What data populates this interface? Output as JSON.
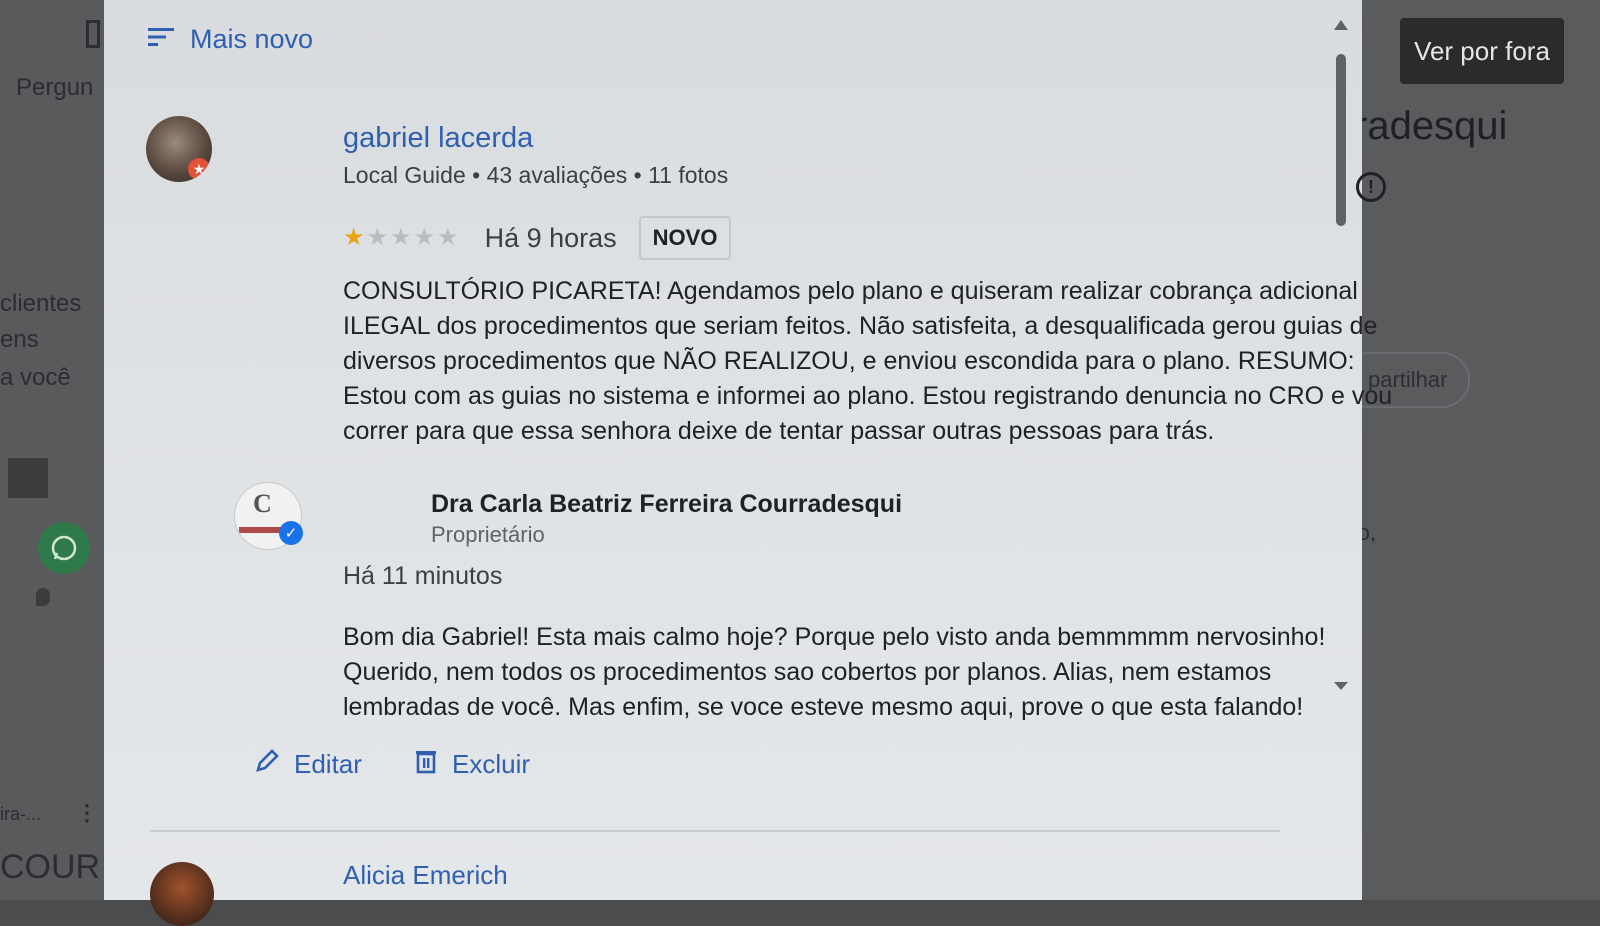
{
  "background": {
    "left_texts": [
      "Pergun",
      "clientes",
      "ens",
      "a você",
      "ira-...",
      "COUR"
    ],
    "right_texts": [
      "radesqui",
      "partilhar",
      "ntro,"
    ],
    "view_button": "Ver por fora"
  },
  "sort": {
    "label": "Mais novo",
    "icon": "sort-icon"
  },
  "review": {
    "author": "gabriel lacerda",
    "meta": "Local Guide • 43 avaliações • 11 fotos",
    "rating": 1,
    "rating_max": 5,
    "time": "Há 9 horas",
    "badge": "NOVO",
    "text": "CONSULTÓRIO PICARETA! Agendamos pelo plano e quiseram realizar cobrança adicional ILEGAL dos procedimentos que seriam feitos. Não satisfeita, a desqualificada gerou guias de diversos procedimentos que NÃO REALIZOU, e enviou escondida para o plano. RESUMO: Estou com as guias no sistema e informei ao plano. Estou registrando denuncia no CRO e vou correr para que essa senhora deixe de tentar passar outras pessoas para trás."
  },
  "owner_reply": {
    "name": "Dra Carla Beatriz Ferreira Courradesqui",
    "role": "Proprietário",
    "time": "Há 11 minutos",
    "text": "Bom dia Gabriel! Esta mais calmo hoje? Porque pelo visto anda bemmmmm nervosinho! Querido, nem todos os procedimentos sao cobertos por planos. Alias, nem estamos lembradas de você. Mas enfim, se voce esteve mesmo aqui, prove o que esta falando!",
    "edit_label": "Editar",
    "delete_label": "Excluir"
  },
  "next_review": {
    "author": "Alicia Emerich"
  },
  "colors": {
    "link_blue": "#2f5fb0",
    "star_gold": "#e8a317",
    "verified_blue": "#1a73e8"
  }
}
